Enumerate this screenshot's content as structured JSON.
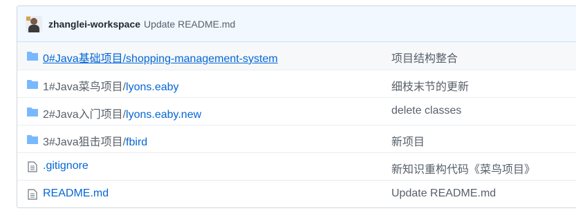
{
  "commit": {
    "author": "zhanglei-workspace",
    "message": "Update README.md"
  },
  "files": [
    {
      "type": "folder",
      "prefix": "0#Java基础项目/",
      "link": "shopping-management-system",
      "commit_message": "项目结构整合"
    },
    {
      "type": "folder",
      "prefix": "1#Java菜鸟项目/",
      "link": "lyons.eaby",
      "commit_message": "细枝末节的更新"
    },
    {
      "type": "folder",
      "prefix": "2#Java入门项目/",
      "link": "lyons.eaby.new",
      "commit_message": "delete classes"
    },
    {
      "type": "folder",
      "prefix": "3#Java狙击项目/",
      "link": "fbird",
      "commit_message": "新项目"
    },
    {
      "type": "file",
      "prefix": "",
      "link": ".gitignore",
      "commit_message": "新知识重构代码《菜鸟项目》"
    },
    {
      "type": "file",
      "prefix": "",
      "link": "README.md",
      "commit_message": "Update README.md"
    }
  ],
  "colors": {
    "folder_icon": "#79b8ff",
    "link": "#0366d6",
    "muted": "#586069"
  }
}
